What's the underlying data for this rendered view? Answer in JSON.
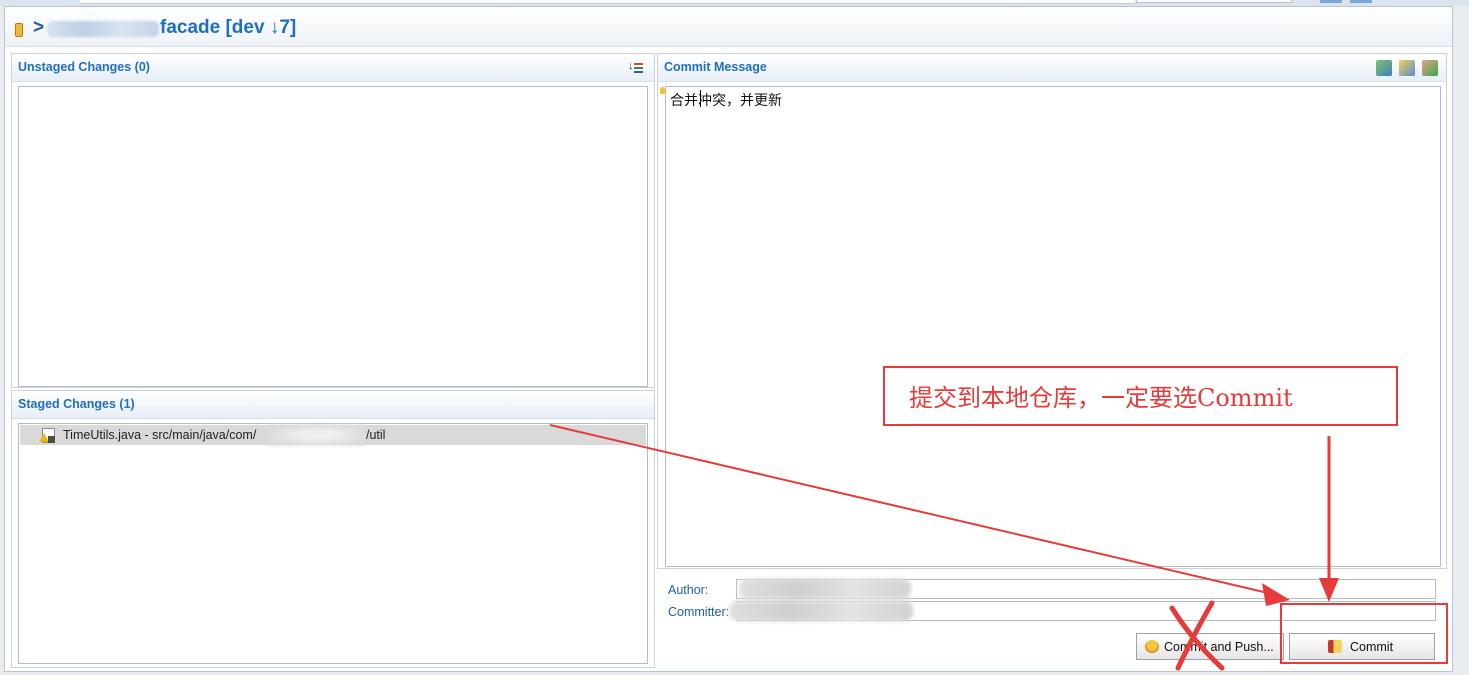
{
  "header": {
    "separator": ">",
    "repo_name": "facade [dev ↓7]",
    "icon": "repository-icon"
  },
  "unstaged": {
    "title": "Unstaged Changes (0)",
    "sort_icon": "sort-icon"
  },
  "staged": {
    "title": "Staged Changes (1)",
    "items": [
      {
        "file": "TimeUtils.java - src/main/java/com/",
        "path_tail": "/util",
        "icon": "java-file-conflict-icon"
      }
    ]
  },
  "commit_message": {
    "title": "Commit Message",
    "text": "合并冲突，并更新",
    "toolbar_icons": [
      "sign-off-icon",
      "amend-icon",
      "change-id-icon"
    ]
  },
  "author": {
    "label": "Author:"
  },
  "committer": {
    "label": "Committer:"
  },
  "buttons": {
    "commit_and_push": "Commit and Push...",
    "commit": "Commit"
  },
  "annotation": {
    "text": "提交到本地仓库，一定要选Commit",
    "color": "#e53b3b"
  }
}
